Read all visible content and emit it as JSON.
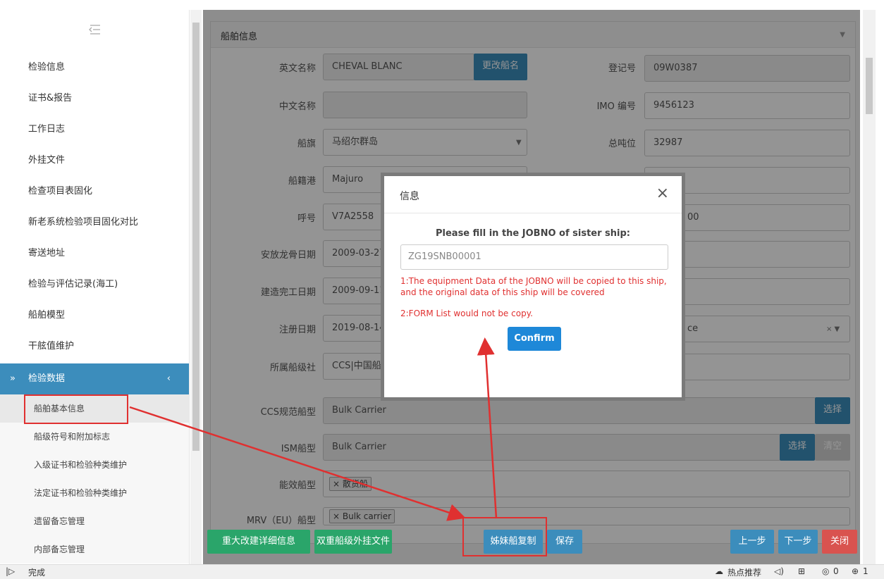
{
  "sidebar": {
    "items": [
      {
        "label": "检验信息"
      },
      {
        "label": "证书&报告"
      },
      {
        "label": "工作日志"
      },
      {
        "label": "外挂文件"
      },
      {
        "label": "检查项目表固化"
      },
      {
        "label": "新老系统检验项目固化对比"
      },
      {
        "label": "寄送地址"
      },
      {
        "label": "检验与评估记录(海工)"
      },
      {
        "label": "船舶模型"
      },
      {
        "label": "干舷值维护"
      }
    ],
    "active": {
      "prefix": "»",
      "label": "检验数据",
      "chevron": "‹"
    },
    "subitems": [
      {
        "label": "船舶基本信息"
      },
      {
        "label": "船级符号和附加标志"
      },
      {
        "label": "入级证书和检验种类维护"
      },
      {
        "label": "法定证书和检验种类维护"
      },
      {
        "label": "遗留备忘管理"
      },
      {
        "label": "内部备忘管理"
      }
    ]
  },
  "panel": {
    "title": "船舶信息"
  },
  "form": {
    "english_name_label": "英文名称",
    "english_name": "CHEVAL BLANC",
    "rename_button": "更改船名",
    "reg_no_label": "登记号",
    "reg_no": "09W0387",
    "chinese_name_label": "中文名称",
    "chinese_name": "",
    "imo_label": "IMO 编号",
    "imo": "9456123",
    "flag_label": "船旗",
    "flag": "马绍尔群岛",
    "gross_tonnage_label": "总吨位",
    "gross_tonnage": "32987",
    "port_label": "船籍港",
    "port": "Majuro",
    "callsign_label": "呼号",
    "callsign": "V7A2558",
    "right_partial_1": "00",
    "keel_label": "安放龙骨日期",
    "keel": "2009-03-27",
    "built_label": "建造完工日期",
    "built": "2009-09-11",
    "reg_date_label": "注册日期",
    "reg_date": "2019-08-14",
    "right_partial_2": "ce",
    "society_label": "所属船级社",
    "society": "CCS|中国船级",
    "ccs_type_label": "CCS规范船型",
    "ccs_type": "Bulk Carrier",
    "select_button": "选择",
    "ism_type_label": "ISM船型",
    "ism_type": "Bulk Carrier",
    "clear_button": "清空",
    "energy_type_label": "能效船型",
    "energy_type_tag": "× 散货船",
    "mrv_type_label": "MRV（EU）船型",
    "mrv_type_tag": "× Bulk carrier"
  },
  "bottom_bar": {
    "major_change": "重大改建详细信息",
    "dual_class": "双重船级外挂文件",
    "sister_copy": "姊妹船复制",
    "save": "保存",
    "prev": "上一步",
    "next": "下一步",
    "close": "关闭"
  },
  "dialog": {
    "title": "信息",
    "close": "×",
    "prompt": "Please fill in the JOBNO of sister ship:",
    "jobno_value": "ZG19SNB00001",
    "note1": "1:The equipment Data of the JOBNO will be copied to this ship, and the original data of this ship will be covered",
    "note2": "2:FORM List would not be copy.",
    "confirm": "Confirm"
  },
  "statusbar": {
    "status": "完成",
    "hot": "热点推荐",
    "count": "0",
    "zoom": "1"
  },
  "colors": {
    "accent": "#3c8dbc",
    "green": "#2aa56a",
    "red": "#d9534f",
    "annotation": "#e03030"
  }
}
